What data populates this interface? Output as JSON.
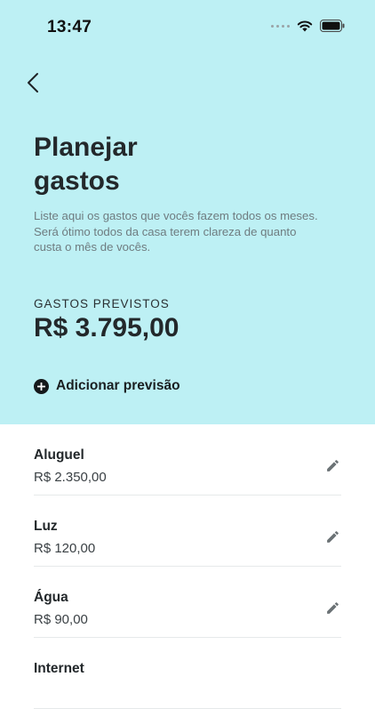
{
  "status_bar": {
    "time": "13:47"
  },
  "header": {
    "title_line1": "Planejar",
    "title_line2": "gastos",
    "description_line1": "Liste aqui os gastos que vocês fazem todos os meses.",
    "description_line2": "Será ótimo todos da casa terem clareza de quanto",
    "description_line3": "custa o mês de vocês.",
    "forecast_label": "GASTOS PREVISTOS",
    "forecast_value": "R$ 3.795,00",
    "add_button_label": "Adicionar previsão",
    "background_color": "#bdf0f4"
  },
  "expenses": [
    {
      "name": "Aluguel",
      "value": "R$ 2.350,00"
    },
    {
      "name": "Luz",
      "value": "R$ 120,00"
    },
    {
      "name": "Água",
      "value": "R$ 90,00"
    },
    {
      "name": "Internet",
      "value": ""
    }
  ],
  "icons": {
    "back": "chevron-left-icon",
    "add": "plus-circle-icon",
    "edit": "pencil-icon",
    "wifi": "wifi-icon",
    "battery": "battery-icon"
  }
}
